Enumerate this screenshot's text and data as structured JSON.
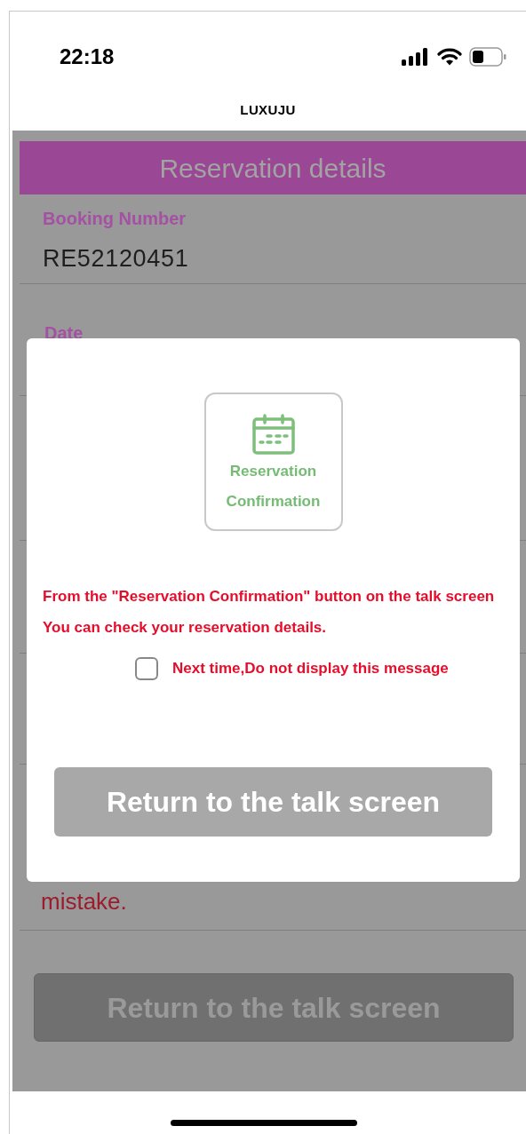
{
  "status_bar": {
    "time": "22:18"
  },
  "app_title": "LUXUJU",
  "page": {
    "title": "Reservation details",
    "fields": [
      {
        "label": "Booking Number",
        "value": "RE52120451"
      },
      {
        "label": "Date"
      }
    ],
    "note": "mistake.",
    "button": "Return to the talk screen"
  },
  "dialog": {
    "tile_label": "Reservation Confirmation",
    "message": "From the \"Reservation Confirmation\" button on the talk screen You can check your reservation details.",
    "checkbox": {
      "label": "Next time,Do not display this message",
      "checked": false
    },
    "button": "Return to the talk screen"
  }
}
